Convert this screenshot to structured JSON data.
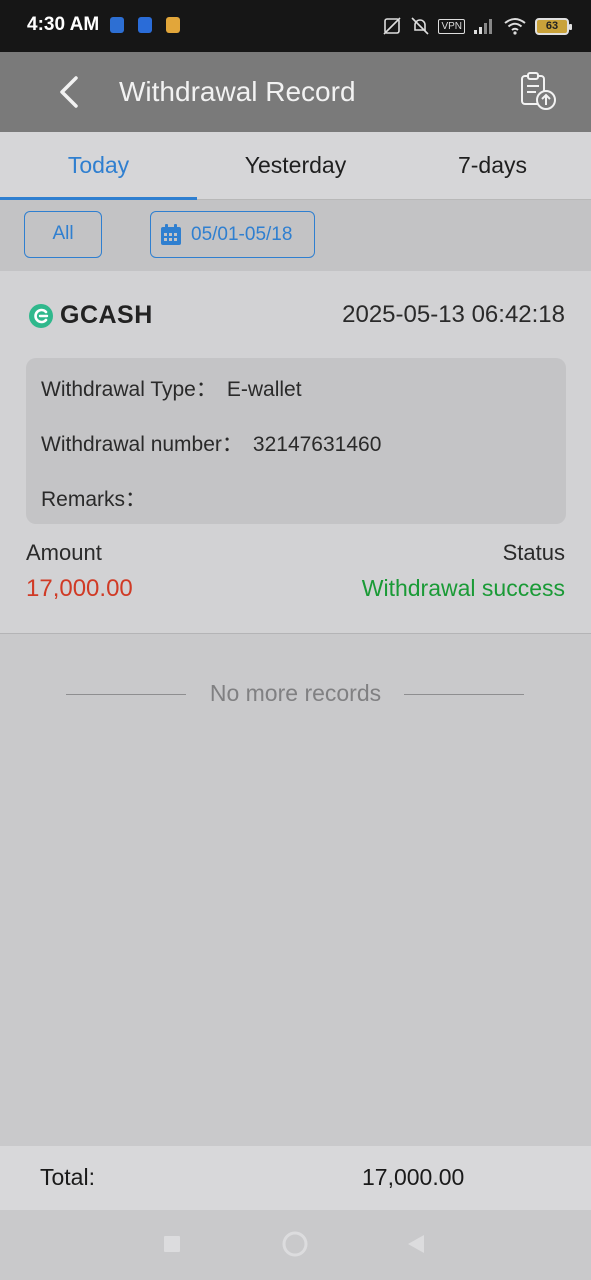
{
  "status_bar": {
    "time": "4:30 AM",
    "vpn": "VPN",
    "battery": "63",
    "icons": [
      "app-notification-icon",
      "app-notification-icon",
      "app-notification-icon",
      "no-sim-icon",
      "mute-icon",
      "vpn-icon",
      "signal-icon",
      "wifi-icon",
      "battery-icon"
    ]
  },
  "app_bar": {
    "title": "Withdrawal Record",
    "back_icon": "chevron-left-icon",
    "action_icon": "clipboard-upload-icon"
  },
  "tabs": [
    {
      "label": "Today",
      "active": true
    },
    {
      "label": "Yesterday",
      "active": false
    },
    {
      "label": "7-days",
      "active": false
    }
  ],
  "filters": {
    "all_label": "All",
    "date_range": "05/01-05/18",
    "date_icon": "calendar-icon"
  },
  "record": {
    "provider": "GCASH",
    "provider_icon": "gcash-logo-icon",
    "datetime": "2025-05-13 06:42:18",
    "withdrawal_type_label": "Withdrawal Type：",
    "withdrawal_type_value": "E-wallet",
    "withdrawal_number_label": "Withdrawal number：",
    "withdrawal_number_value": "32147631460",
    "remarks_label": "Remarks：",
    "remarks_value": "",
    "amount_label": "Amount",
    "amount_value": "17,000.00",
    "status_label": "Status",
    "status_value": "Withdrawal success"
  },
  "list_end": {
    "text": "No more records"
  },
  "footer": {
    "total_label": "Total:",
    "total_value": "17,000.00"
  },
  "colors": {
    "accent": "#2f7fd0",
    "amount": "#d03a25",
    "success": "#1a9a36",
    "gcash": "#2fb88c"
  }
}
